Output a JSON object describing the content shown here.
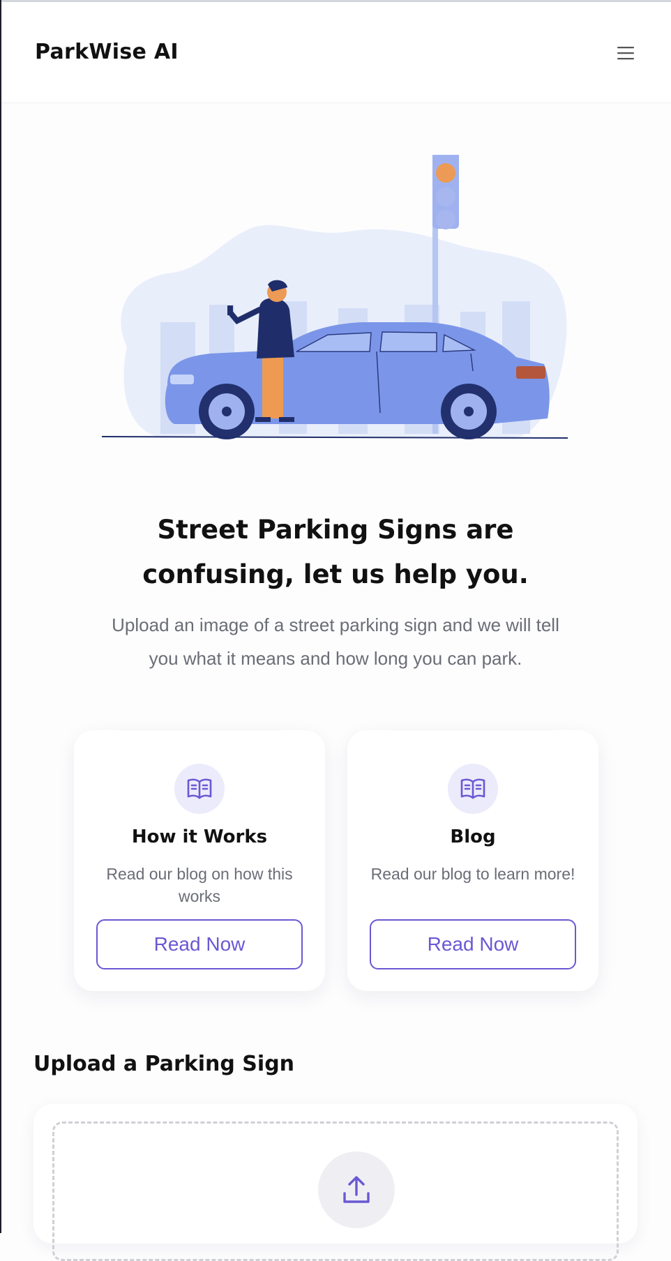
{
  "app": {
    "brand": "ParkWise AI"
  },
  "header": {
    "menu_icon": "hamburger-menu-icon"
  },
  "hero": {
    "headline": "Street Parking Signs are confusing, let us help you.",
    "subtext": "Upload an image of a street parking sign and we will tell you what it means and how long you can park."
  },
  "cards": [
    {
      "icon": "book-open-icon",
      "title": "How it Works",
      "description": "Read our blog on how this works",
      "button": "Read Now"
    },
    {
      "icon": "book-open-icon",
      "title": "Blog",
      "description": "Read our blog to learn more!",
      "button": "Read Now"
    }
  ],
  "upload": {
    "title": "Upload a Parking Sign",
    "icon": "upload-icon"
  },
  "colors": {
    "accent": "#6a58d3",
    "illustration": "#7b96e8",
    "text_muted": "#6a6d75"
  }
}
